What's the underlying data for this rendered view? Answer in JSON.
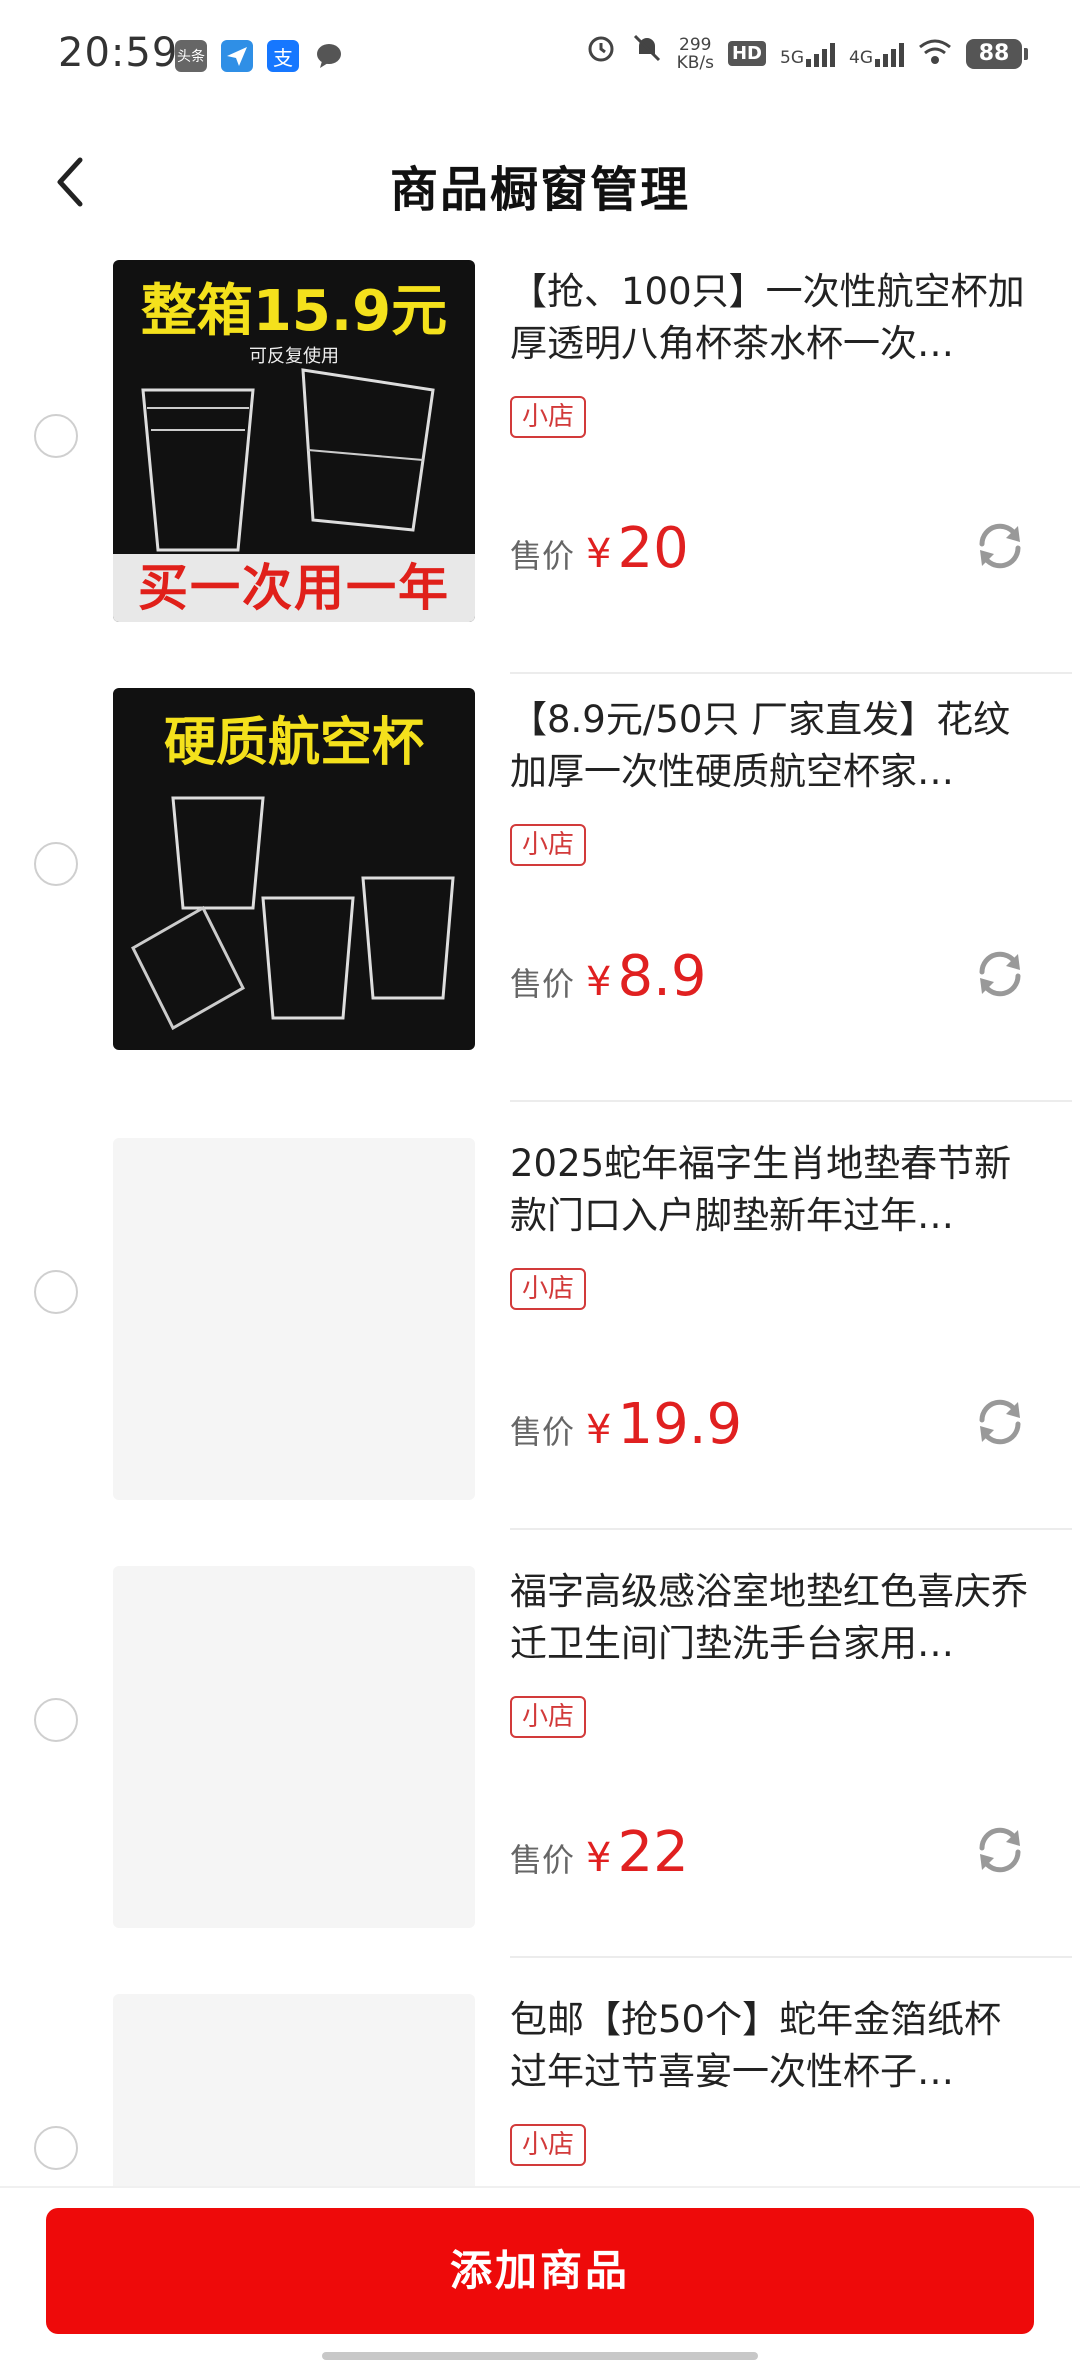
{
  "status_bar": {
    "time": "20:59",
    "apps": [
      "toutiao-icon",
      "paper-plane-icon",
      "alipay-icon",
      "chat-bubble-icon"
    ],
    "app_labels": {
      "toutiao": "头条",
      "alipay": "支"
    },
    "net_speed_value": "299",
    "net_speed_unit": "KB/s",
    "hd_label": "HD",
    "sim1_label": "5G",
    "sim2_label": "4G",
    "battery": "88"
  },
  "header": {
    "title": "商品橱窗管理"
  },
  "items": [
    {
      "title": "【抢、100只】一次性航空杯加厚透明八角杯茶水杯一次…",
      "tag": "小店",
      "price_label": "售价",
      "currency": "¥",
      "price": "20",
      "thumb": {
        "headline": "整箱15.9元",
        "sub": "可反复使用",
        "band": "买一次用一年"
      }
    },
    {
      "title": "【8.9元/50只 厂家直发】花纹加厚一次性硬质航空杯家…",
      "tag": "小店",
      "price_label": "售价",
      "currency": "¥",
      "price": "8.9",
      "thumb": {
        "headline": "硬质航空杯"
      }
    },
    {
      "title": "2025蛇年福字生肖地垫春节新款门口入户脚垫新年过年…",
      "tag": "小店",
      "price_label": "售价",
      "currency": "¥",
      "price": "19.9"
    },
    {
      "title": "福字高级感浴室地垫红色喜庆乔迁卫生间门垫洗手台家用…",
      "tag": "小店",
      "price_label": "售价",
      "currency": "¥",
      "price": "22"
    },
    {
      "title": "包邮【抢50个】蛇年金箔纸杯过年过节喜宴一次性杯子…",
      "tag": "小店"
    }
  ],
  "bottom": {
    "add_button": "添加商品"
  },
  "colors": {
    "accent": "#ee0a0a",
    "price": "#e02020",
    "tag": "#d23a3a"
  }
}
